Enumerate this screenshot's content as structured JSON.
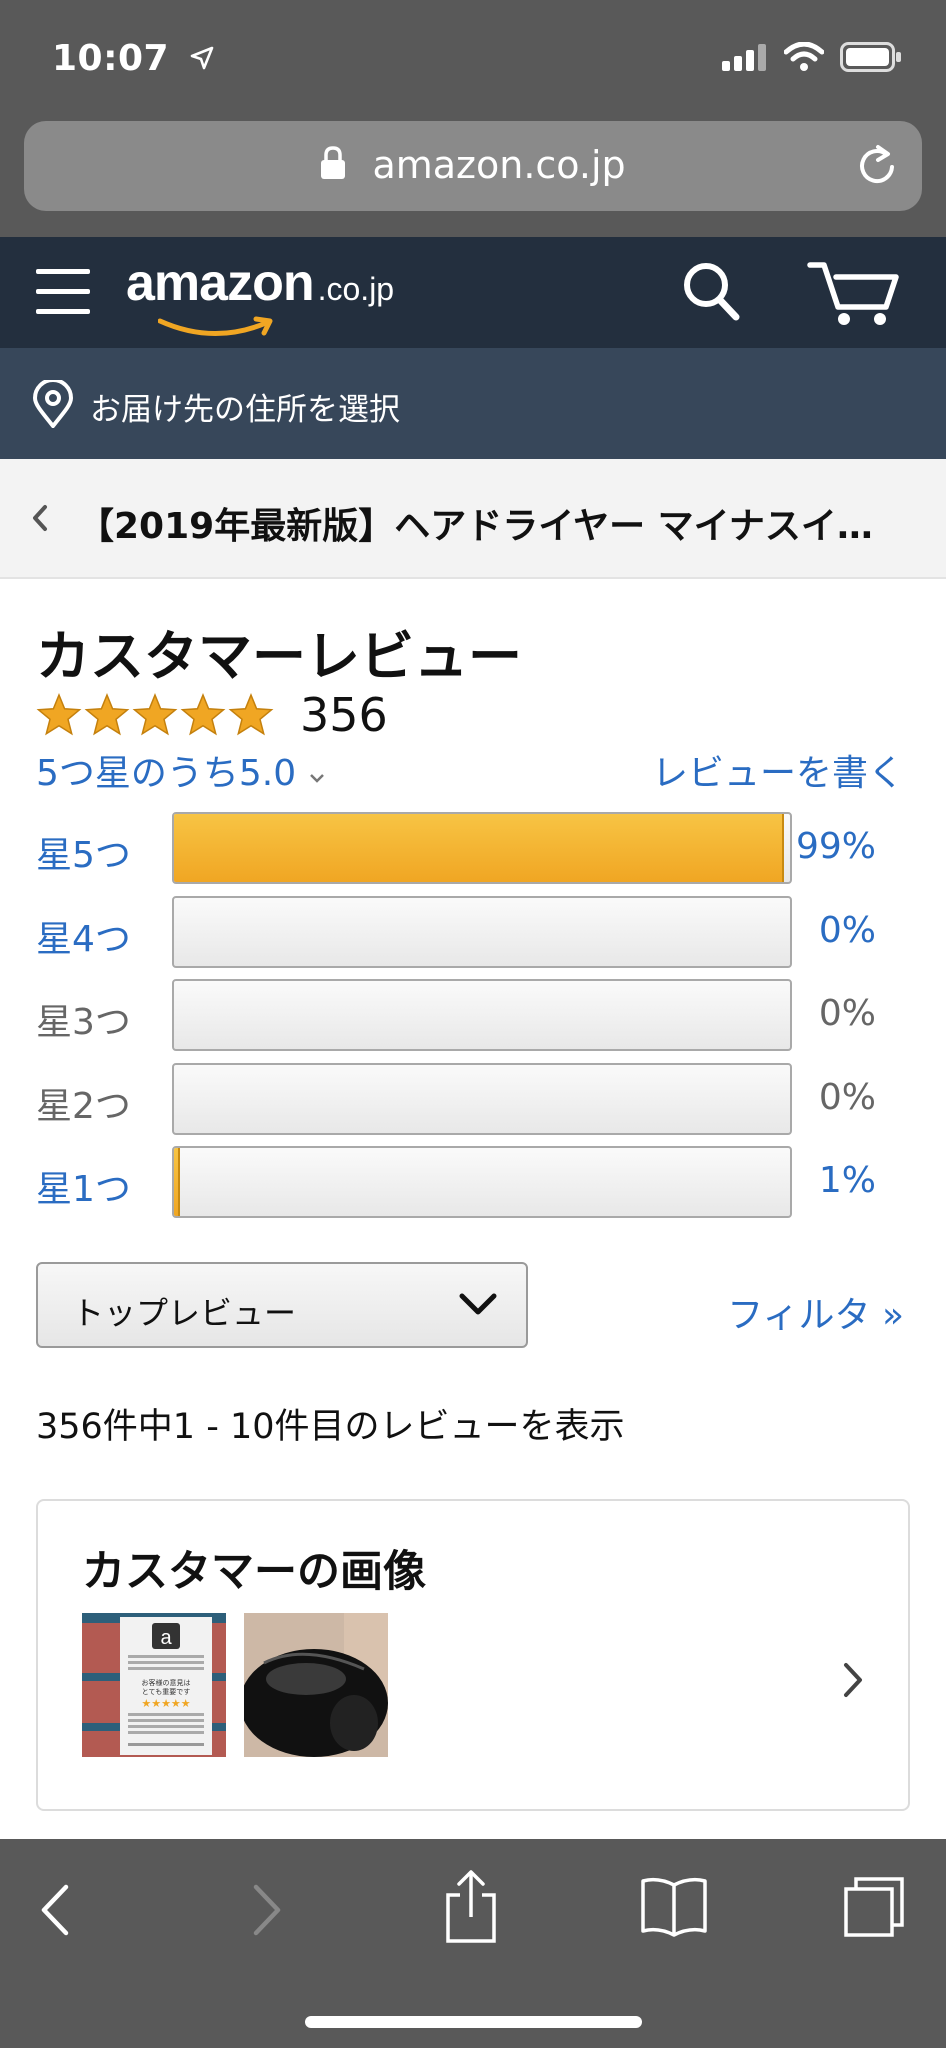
{
  "status_bar": {
    "time": "10:07"
  },
  "browser": {
    "url": "amazon.co.jp"
  },
  "header": {
    "logo_main": "amazon",
    "logo_suffix": ".co.jp"
  },
  "delivery": {
    "label": "お届け先の住所を選択"
  },
  "breadcrumb": {
    "title": "【2019年最新版】ヘアドライヤー マイナスイ…"
  },
  "reviews": {
    "heading": "カスタマーレビュー",
    "rating_stars": 5,
    "total_count": "356",
    "rating_text": "5つ星のうち5.0",
    "write_review": "レビューを書く",
    "histogram": [
      {
        "label": "星5つ",
        "percent_text": "99%",
        "percent": 99,
        "linked": true
      },
      {
        "label": "星4つ",
        "percent_text": "0%",
        "percent": 0,
        "linked": true
      },
      {
        "label": "星3つ",
        "percent_text": "0%",
        "percent": 0,
        "linked": false
      },
      {
        "label": "星2つ",
        "percent_text": "0%",
        "percent": 0,
        "linked": false
      },
      {
        "label": "星1つ",
        "percent_text": "1%",
        "percent": 1,
        "linked": true
      }
    ],
    "sort_selected": "トップレビュー",
    "filter_label": "フィルタ »",
    "summary": "356件中1 - 10件目のレビューを表示"
  },
  "customer_images": {
    "title": "カスタマーの画像",
    "thumb1_text": "お客様の意見はとても重要です"
  },
  "colors": {
    "chrome_gray": "#595959",
    "amazon_navy": "#232f3e",
    "delivery_bar": "#37475a",
    "link_blue": "#2a6cc2",
    "star_orange": "#f0a623"
  }
}
